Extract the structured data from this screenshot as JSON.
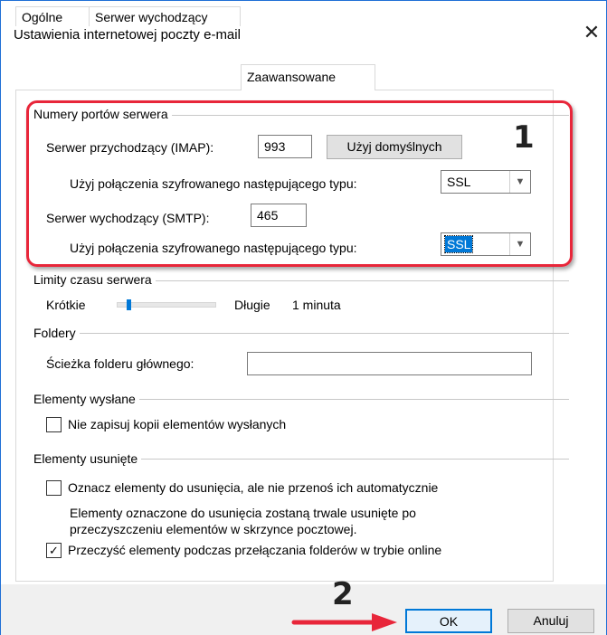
{
  "dialog": {
    "title": "Ustawienia internetowej poczty e-mail",
    "close_glyph": "✕"
  },
  "tabs": [
    {
      "label": "Ogólne",
      "active": false
    },
    {
      "label": "Serwer wychodzący",
      "active": false
    },
    {
      "label": "Zaawansowane",
      "active": true
    }
  ],
  "ports": {
    "group_title": "Numery portów serwera",
    "incoming_label": "Serwer przychodzący (IMAP):",
    "incoming_value": "993",
    "use_defaults": "Użyj domyślnych",
    "incoming_encrypt_label": "Użyj połączenia szyfrowanego następującego typu:",
    "incoming_encrypt_value": "SSL",
    "outgoing_label": "Serwer wychodzący (SMTP):",
    "outgoing_value": "465",
    "outgoing_encrypt_label": "Użyj połączenia szyfrowanego następującego typu:",
    "outgoing_encrypt_value": "SSL"
  },
  "timeouts": {
    "group_title": "Limity czasu serwera",
    "short": "Krótkie",
    "long": "Długie",
    "value": "1 minuta",
    "level": 0.1
  },
  "folders": {
    "group_title": "Foldery",
    "root_label": "Ścieżka folderu głównego:",
    "root_value": ""
  },
  "sent": {
    "group_title": "Elementy wysłane",
    "no_copy_label": "Nie zapisuj kopii elementów wysłanych",
    "no_copy_checked": false
  },
  "deleted": {
    "group_title": "Elementy usunięte",
    "mark_label": "Oznacz elementy do usunięcia, ale nie przenoś ich automatycznie",
    "mark_checked": false,
    "note_line1": "Elementy oznaczone do usunięcia zostaną trwale usunięte po",
    "note_line2": "przeczyszczeniu elementów w skrzynce pocztowej.",
    "purge_label": "Przeczyść elementy podczas przełączania folderów w trybie online",
    "purge_checked": true
  },
  "buttons": {
    "ok": "OK",
    "cancel": "Anuluj"
  },
  "annotations": {
    "one": "1",
    "two": "2",
    "highlight_color": "#e8263a"
  }
}
